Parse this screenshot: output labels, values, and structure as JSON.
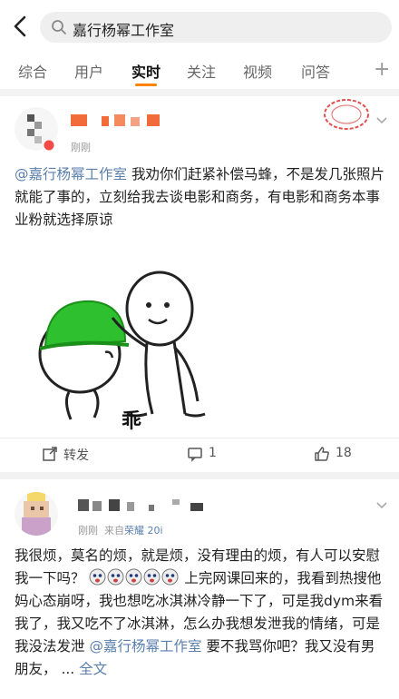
{
  "search": {
    "query": "嘉行杨幂工作室"
  },
  "tabs": [
    {
      "label": "综合"
    },
    {
      "label": "用户"
    },
    {
      "label": "实时"
    },
    {
      "label": "关注"
    },
    {
      "label": "视频"
    },
    {
      "label": "问答"
    }
  ],
  "tabs_plus": "+",
  "posts": [
    {
      "time": "刚刚",
      "mention": "@嘉行杨幂工作室",
      "text": " 我劝你们赶紧补偿马蜂，不是发几张照片就能了事的，立刻给我去谈电影和商务，有电影和商务本事业粉就选择原谅",
      "meme_caption": "乖",
      "actions": {
        "repost": "转发",
        "comments": "1",
        "likes": "18"
      }
    },
    {
      "time": "刚刚",
      "source_prefix": "来自",
      "source_device": "荣耀 20i",
      "text_a": "我很烦，莫名的烦，就是烦，没有理由的烦，有人可以安慰我一下吗？",
      "text_b": "上完网课回来的，我看到热搜他妈心态崩呀，我也想吃冰淇淋冷静一下了，可是我dym来看我了，我又吃不了冰淇淋，怎么办我想发泄我的情绪，可是我没法发泄",
      "mention": "@嘉行杨幂工作室",
      "text_c": " 要不我骂你吧？我又没有男朋友，",
      "ellipsis": " ... ",
      "more": "全文"
    }
  ],
  "colors": {
    "accent": "#ff8200",
    "link": "#5a7fad",
    "helmet": "#2ec02e"
  }
}
